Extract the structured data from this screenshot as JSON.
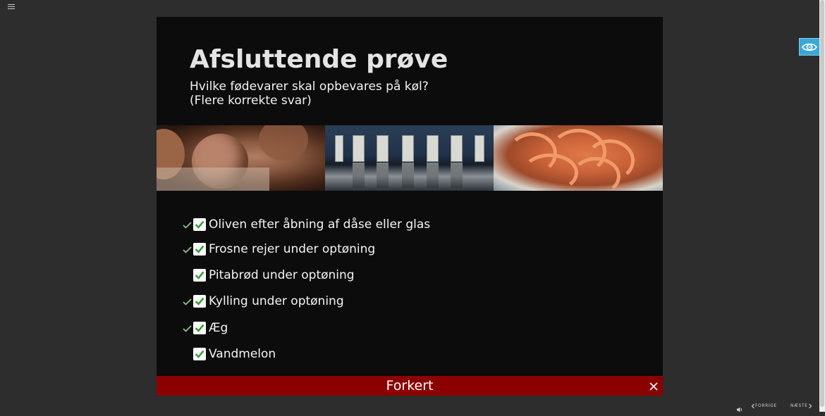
{
  "slide": {
    "title": "Afsluttende prøve",
    "question_line1": "Hvilke fødevarer skal opbevares på køl?",
    "question_line2": "(Flere korrekte svar)"
  },
  "images": [
    {
      "icon": "eggs-photo"
    },
    {
      "icon": "doors-photo"
    },
    {
      "icon": "shrimp-photo"
    }
  ],
  "options": [
    {
      "label": "Oliven efter åbning af dåse eller glas",
      "checked": true,
      "correct_marker": true
    },
    {
      "label": "Frosne rejer under optøning",
      "checked": true,
      "correct_marker": true
    },
    {
      "label": "Pitabrød under optøning",
      "checked": true,
      "correct_marker": false
    },
    {
      "label": "Kylling under optøning",
      "checked": true,
      "correct_marker": true
    },
    {
      "label": "Æg",
      "checked": true,
      "correct_marker": true
    },
    {
      "label": "Vandmelon",
      "checked": true,
      "correct_marker": false
    }
  ],
  "feedback": {
    "text": "Forkert",
    "color": "#8b0000"
  },
  "nav": {
    "prev_label": "FORRIGE",
    "next_label": "NÆSTE"
  },
  "colors": {
    "accent": "#3aa8d8",
    "check_green": "#3c9b3c"
  }
}
